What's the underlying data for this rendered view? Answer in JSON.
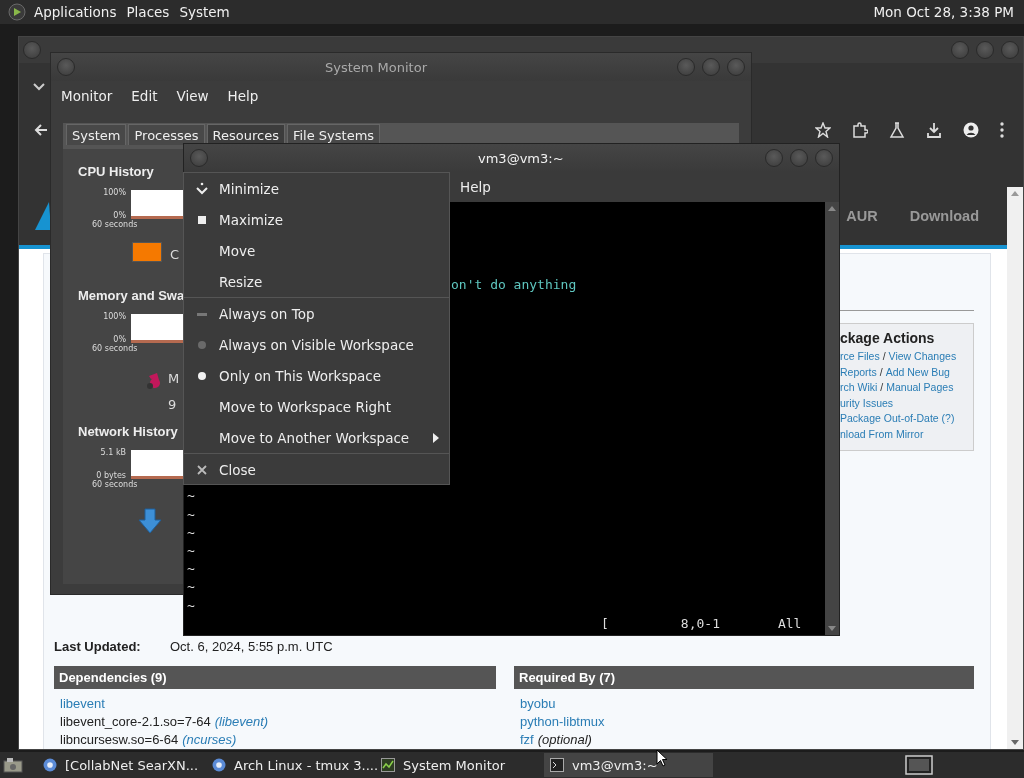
{
  "top_panel": {
    "menus": [
      "Applications",
      "Places",
      "System"
    ],
    "clock": "Mon Oct 28, 3:38 PM"
  },
  "browser": {
    "nav_links": [
      "AUR",
      "Download"
    ],
    "package_actions": {
      "title": "ckage Actions",
      "lines": [
        [
          {
            "text": "rce Files",
            "kind": "link"
          },
          {
            "text": "/",
            "kind": "plain"
          },
          {
            "text": "View Changes",
            "kind": "link"
          }
        ],
        [
          {
            "text": "Reports",
            "kind": "link"
          },
          {
            "text": "/",
            "kind": "plain"
          },
          {
            "text": "Add New Bug",
            "kind": "link"
          }
        ],
        [
          {
            "text": "rch Wiki",
            "kind": "link"
          },
          {
            "text": "/",
            "kind": "plain"
          },
          {
            "text": "Manual Pages",
            "kind": "link"
          }
        ],
        [
          {
            "text": "urity Issues",
            "kind": "link"
          }
        ],
        [
          {
            "text": "Package Out-of-Date (?)",
            "kind": "link"
          }
        ],
        [
          {
            "text": "nload From Mirror",
            "kind": "link"
          }
        ]
      ]
    },
    "last_updated": {
      "label": "Last Updated:",
      "value": "Oct. 6, 2024, 5:55 p.m. UTC"
    },
    "panels": [
      {
        "title": "Dependencies (9)",
        "items": [
          {
            "name": "libevent",
            "kind": "link"
          },
          {
            "name": "libevent_core-2.1.so=7-64",
            "kind": "plain",
            "note": {
              "text": "(libevent)",
              "kind": "link"
            }
          },
          {
            "name": "libncursesw.so=6-64",
            "kind": "plain",
            "note": {
              "text": "(ncurses)",
              "kind": "link"
            }
          }
        ]
      },
      {
        "title": "Required By (7)",
        "items": [
          {
            "name": "byobu",
            "kind": "link"
          },
          {
            "name": "python-libtmux",
            "kind": "link"
          },
          {
            "name": "fzf",
            "kind": "link",
            "note": {
              "text": "(optional)",
              "kind": "plain"
            }
          }
        ]
      }
    ]
  },
  "system_monitor": {
    "title": "System Monitor",
    "menus": [
      "Monitor",
      "Edit",
      "View",
      "Help"
    ],
    "tabs": [
      {
        "label": "System",
        "selected": false
      },
      {
        "label": "Processes",
        "selected": false
      },
      {
        "label": "Resources",
        "selected": true
      },
      {
        "label": "File Systems",
        "selected": false
      }
    ],
    "sections": [
      {
        "title": "CPU History",
        "y_max": "100%",
        "y_min": "0%",
        "x_label": "60 seconds",
        "legend": {
          "kind": "swatch",
          "color": "#f57900"
        },
        "legend_texts": [
          "C"
        ]
      },
      {
        "title": "Memory and Swa",
        "y_max": "100%",
        "y_min": "0%",
        "x_label": "60 seconds",
        "legend": {
          "kind": "pie",
          "color": "#c2185b"
        },
        "legend_texts": [
          "M",
          "9"
        ]
      },
      {
        "title": "Network History",
        "y_max": "5.1 kB",
        "y_min": "0 bytes",
        "x_label": "60 seconds",
        "legend": {
          "kind": "download",
          "color": "#3d8fd6"
        }
      }
    ]
  },
  "terminal": {
    "title": "vm3@vm3:~",
    "menus": [
      "Help"
    ],
    "text_line": "on't do anything",
    "tildes": [
      "~",
      "~",
      "~",
      "~",
      "~",
      "~",
      "~"
    ],
    "status": [
      "[",
      "8,0-1",
      "All"
    ]
  },
  "window_menu": {
    "groups": [
      [
        {
          "label": "Minimize",
          "kind": "minimize"
        },
        {
          "label": "Maximize",
          "kind": "maximize"
        },
        {
          "label": "Move",
          "kind": "plain"
        },
        {
          "label": "Resize",
          "kind": "plain"
        }
      ],
      [
        {
          "label": "Always on Top",
          "kind": "check",
          "checked": false
        },
        {
          "label": "Always on Visible Workspace",
          "kind": "radio",
          "selected": false
        },
        {
          "label": "Only on This Workspace",
          "kind": "radio",
          "selected": true
        },
        {
          "label": "Move to Workspace Right",
          "kind": "plain"
        },
        {
          "label": "Move to Another Workspace",
          "kind": "submenu"
        }
      ],
      [
        {
          "label": "Close",
          "kind": "close"
        }
      ]
    ]
  },
  "taskbar": {
    "items": [
      {
        "label": "[CollabNet SearXN...",
        "kind": "browser",
        "selected": false
      },
      {
        "label": "Arch Linux - tmux 3....",
        "kind": "browser",
        "selected": false
      },
      {
        "label": "System Monitor",
        "kind": "monitor",
        "selected": false
      },
      {
        "label": "vm3@vm3:~",
        "kind": "terminal",
        "selected": true
      }
    ]
  }
}
